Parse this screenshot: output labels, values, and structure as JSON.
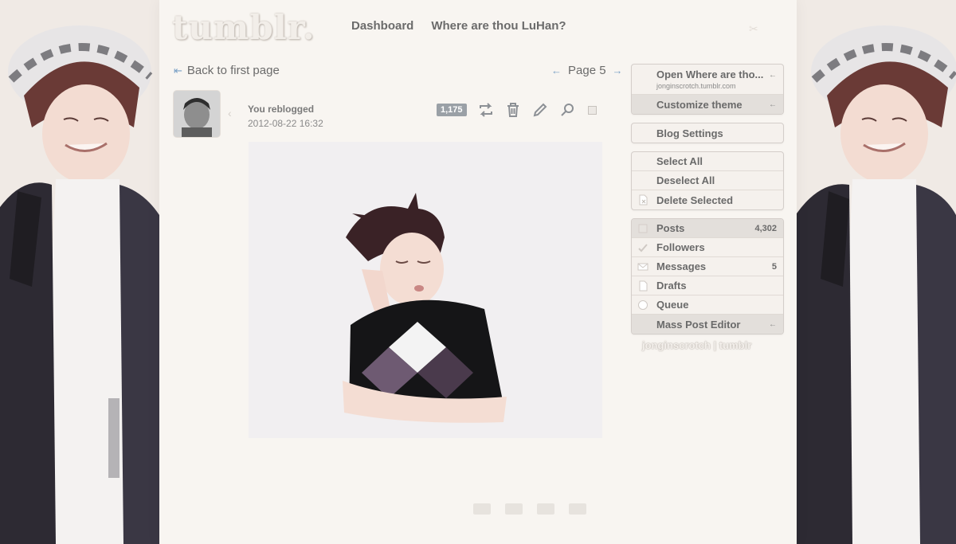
{
  "header": {
    "logo_text": "tumblr.",
    "nav": [
      "Dashboard",
      "Where are thou LuHan?"
    ]
  },
  "pager": {
    "back_arrow": "⇤",
    "back_label": "Back to first page",
    "prev_arrow": "←",
    "page_label": "Page 5",
    "next_arrow": "→"
  },
  "post": {
    "who": "You reblogged",
    "when": "2012-08-22 16:32",
    "notes": "1,175"
  },
  "sidebar": {
    "blog_box": {
      "title": "Open Where are tho...",
      "subtitle": "jonginscrotch.tumblr.com",
      "customize": "Customize theme",
      "chevron": "←"
    },
    "settings": "Blog Settings",
    "selection": [
      "Select All",
      "Deselect All",
      "Delete Selected"
    ],
    "stats": [
      {
        "label": "Posts",
        "count": "4,302",
        "icon": "posts-icon"
      },
      {
        "label": "Followers",
        "count": "",
        "icon": "followers-icon"
      },
      {
        "label": "Messages",
        "count": "5",
        "icon": "messages-icon"
      },
      {
        "label": "Drafts",
        "count": "",
        "icon": "drafts-icon"
      },
      {
        "label": "Queue",
        "count": "",
        "icon": "queue-icon"
      },
      {
        "label": "Mass Post Editor",
        "count": "←",
        "icon": "mass-editor-icon"
      }
    ]
  },
  "blog_caption": "jonginscrotch | tumblr",
  "colors": {
    "accent": "#7aa1c6",
    "badge": "#9aa0a6",
    "background": "#f8f5f1"
  }
}
